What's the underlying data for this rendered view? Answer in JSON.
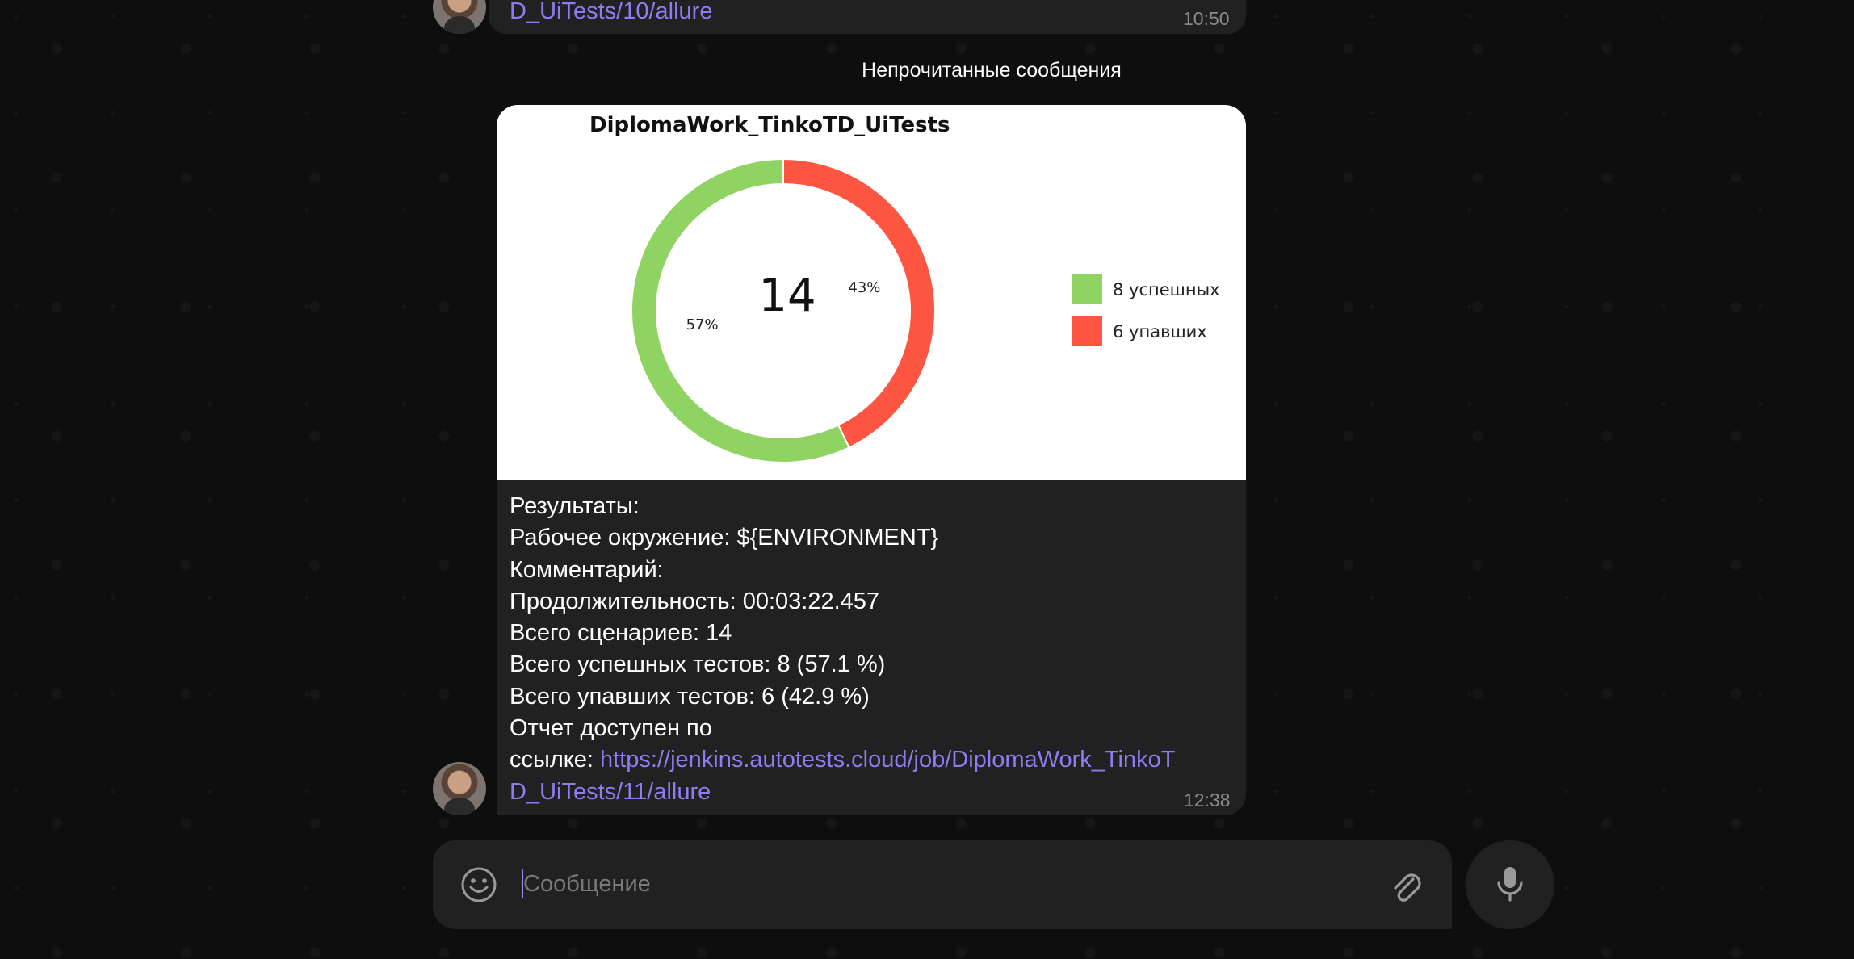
{
  "previous_message": {
    "link_tail": "D_UiTests/10/allure",
    "time": "10:50"
  },
  "unread_divider": "Непрочитанные сообщения",
  "message": {
    "chart_data": {
      "type": "pie",
      "title": "DiplomaWork_TinkoTD_UiTests",
      "center_label": "14",
      "slices": [
        {
          "name": "8 успешных",
          "value": 8,
          "percent_label": "57%",
          "color": "#8fd462"
        },
        {
          "name": "6 упавших",
          "value": 6,
          "percent_label": "43%",
          "color": "#fc5642"
        }
      ],
      "legend_position": "right"
    },
    "lines": {
      "results": "Результаты:",
      "environment": "Рабочее окружение: ${ENVIRONMENT}",
      "comment": "Комментарий:",
      "duration": "Продолжительность: 00:03:22.457",
      "total_scenarios": "Всего сценариев: 14",
      "total_passed": "Всего успешных тестов: 8 (57.1 %)",
      "total_failed": "Всего упавших тестов: 6 (42.9 %)",
      "report_available": "Отчет доступен по",
      "link_prefix": "ссылке: ",
      "link_part1": "https://jenkins.autotests.cloud/job/DiplomaWork_TinkoT",
      "link_part2": "D_UiTests/11/allure"
    },
    "time": "12:38"
  },
  "composer": {
    "placeholder": "Сообщение"
  },
  "icons": {
    "emoji": "emoji-icon",
    "attach": "paperclip-icon",
    "mic": "microphone-icon"
  },
  "colors": {
    "link": "#8f7cf2",
    "bubble": "#212121",
    "background": "#0e0e0e"
  }
}
